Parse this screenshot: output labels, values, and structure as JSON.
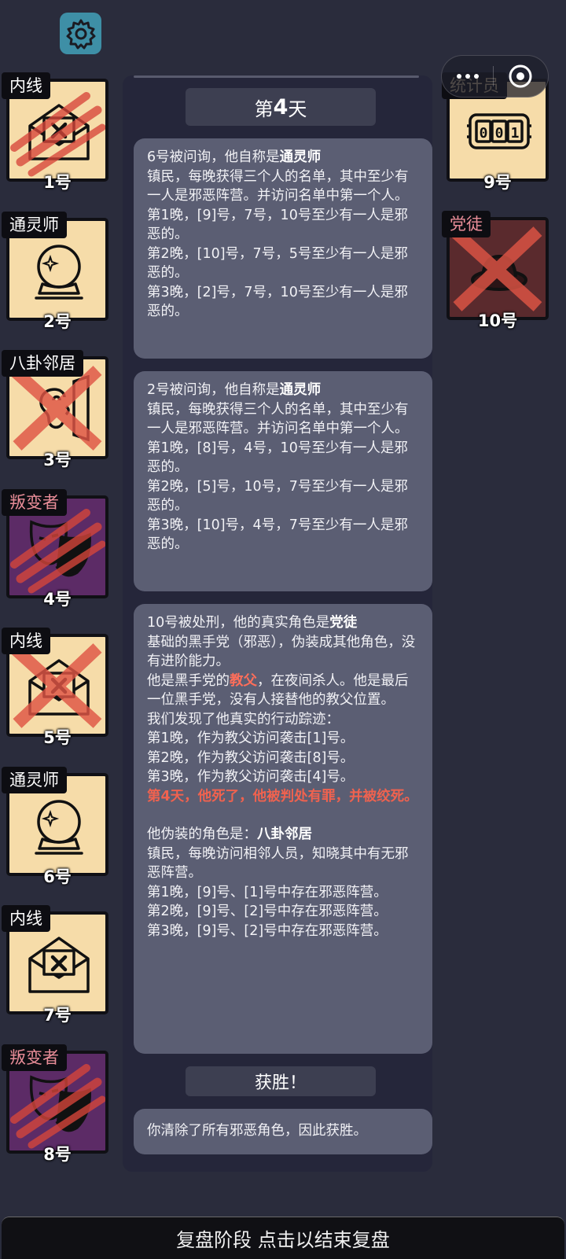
{
  "header": {
    "settings_icon": "gear-icon",
    "miniprogram_menu_icon": "more-dots-icon",
    "miniprogram_close_icon": "target-close-icon"
  },
  "left_players": [
    {
      "role": "内线",
      "number": "1号",
      "icon": "envelope-x-icon",
      "dead": true,
      "overlay": "claw-marks"
    },
    {
      "role": "通灵师",
      "number": "2号",
      "icon": "crystal-ball-icon",
      "dead": false
    },
    {
      "role": "八卦邻居",
      "number": "3号",
      "icon": "ear-wall-icon",
      "dead": true,
      "overlay": "red-x"
    },
    {
      "role": "叛变者",
      "number": "4号",
      "icon": "mask-icon",
      "dead": true,
      "overlay": "claw-marks"
    },
    {
      "role": "内线",
      "number": "5号",
      "icon": "envelope-x-icon",
      "dead": true,
      "overlay": "red-x"
    },
    {
      "role": "通灵师",
      "number": "6号",
      "icon": "crystal-ball-icon",
      "dead": false
    },
    {
      "role": "内线",
      "number": "7号",
      "icon": "envelope-x-icon",
      "dead": false
    },
    {
      "role": "叛变者",
      "number": "8号",
      "icon": "mask-icon",
      "dead": true,
      "overlay": "claw-marks"
    }
  ],
  "right_players": [
    {
      "role": "统计员",
      "number": "9号",
      "icon": "counter-icon",
      "dead": false
    },
    {
      "role": "党徒",
      "number": "10号",
      "icon": "hat-icon",
      "dead": true,
      "overlay": "red-x"
    }
  ],
  "log": {
    "day_title": {
      "prefix": "第",
      "num": "4",
      "suffix": "天"
    },
    "msg1": {
      "intro": "6号被问询，他自称是",
      "role": "通灵师",
      "lines": [
        "镇民，每晚获得三个人的名单，其中至少有一人是邪恶阵营。并访问名单中第一个人。",
        "第1晚，[9]号，7号，10号至少有一人是邪恶的。",
        "第2晚，[10]号，7号，5号至少有一人是邪恶的。",
        "第3晚，[2]号，7号，10号至少有一人是邪恶的。"
      ]
    },
    "msg2": {
      "intro": "2号被问询，他自称是",
      "role": "通灵师",
      "lines": [
        "镇民，每晚获得三个人的名单，其中至少有一人是邪恶阵营。并访问名单中第一个人。",
        "第1晚，[8]号，4号，10号至少有一人是邪恶的。",
        "第2晚，[5]号，10号，7号至少有一人是邪恶的。",
        "第3晚，[10]号，4号，7号至少有一人是邪恶的。"
      ]
    },
    "msg3": {
      "intro": "10号被处刑，他的真实角色是",
      "role": "党徒",
      "line1": "基础的黑手党（邪恶），伪装成其他角色，没有进阶能力。",
      "line2_pre": "他是黑手党的",
      "line2_hl": "教父",
      "line2_post": "，在夜间杀人。他是最后一位黑手党，没有人接替他的教父位置。",
      "lines": [
        "我们发现了他真实的行动踪迹：",
        "第1晚，作为教父访问袭击[1]号。",
        "第2晚，作为教父访问袭击[8]号。",
        "第3晚，作为教父访问袭击[4]号。"
      ],
      "death": "第4天，他死了，他被判处有罪，并被绞死。",
      "disguise_pre": "他伪装的角色是：",
      "disguise_role": "八卦邻居",
      "lines2": [
        "镇民，每晚访问相邻人员，知晓其中有无邪恶阵营。",
        "第1晚，[9]号、[1]号中存在邪恶阵营。",
        "第2晚，[9]号、[2]号中存在邪恶阵营。",
        "第3晚，[9]号、[2]号中存在邪恶阵营。"
      ]
    },
    "victory_title": "获胜！",
    "victory_text": "你清除了所有邪恶角色，因此获胜。"
  },
  "bottom_bar": "复盘阶段 点击以结束复盘"
}
